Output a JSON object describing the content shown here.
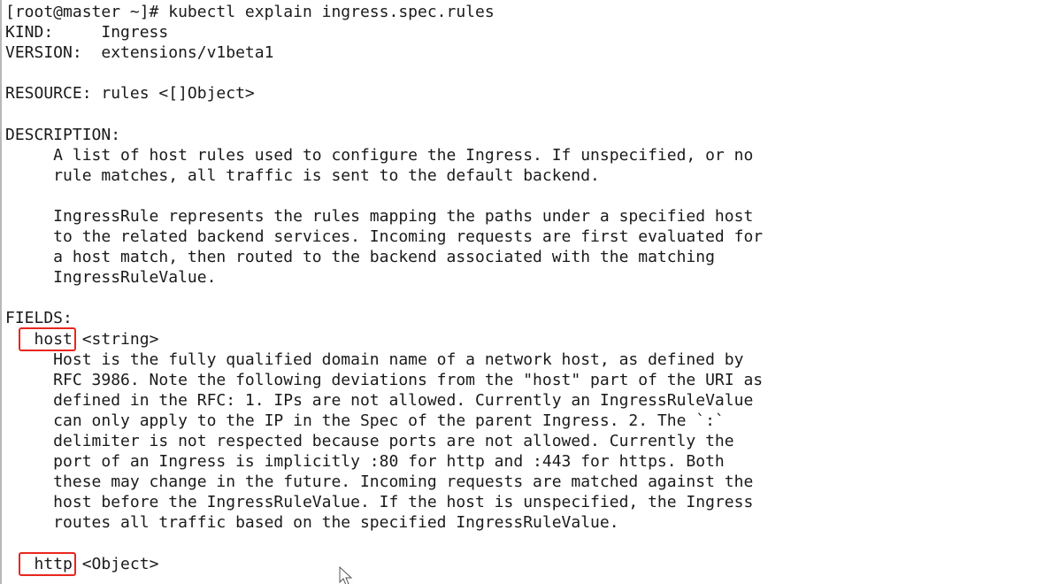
{
  "terminal": {
    "lines": [
      "[root@master ~]# kubectl explain ingress.spec.rules",
      "KIND:     Ingress",
      "VERSION:  extensions/v1beta1",
      "",
      "RESOURCE: rules <[]Object>",
      "",
      "DESCRIPTION:",
      "     A list of host rules used to configure the Ingress. If unspecified, or no",
      "     rule matches, all traffic is sent to the default backend.",
      "",
      "     IngressRule represents the rules mapping the paths under a specified host",
      "     to the related backend services. Incoming requests are first evaluated for",
      "     a host match, then routed to the backend associated with the matching",
      "     IngressRuleValue.",
      "",
      "FIELDS:",
      "   host\t<string>",
      "     Host is the fully qualified domain name of a network host, as defined by",
      "     RFC 3986. Note the following deviations from the \"host\" part of the URI as",
      "     defined in the RFC: 1. IPs are not allowed. Currently an IngressRuleValue",
      "     can only apply to the IP in the Spec of the parent Ingress. 2. The `:`",
      "     delimiter is not respected because ports are not allowed. Currently the",
      "     port of an Ingress is implicitly :80 for http and :443 for https. Both",
      "     these may change in the future. Incoming requests are matched against the",
      "     host before the IngressRuleValue. If the host is unspecified, the Ingress",
      "     routes all traffic based on the specified IngressRuleValue.",
      "",
      "   http\t<Object>"
    ],
    "highlight_color": "#e8261e"
  }
}
